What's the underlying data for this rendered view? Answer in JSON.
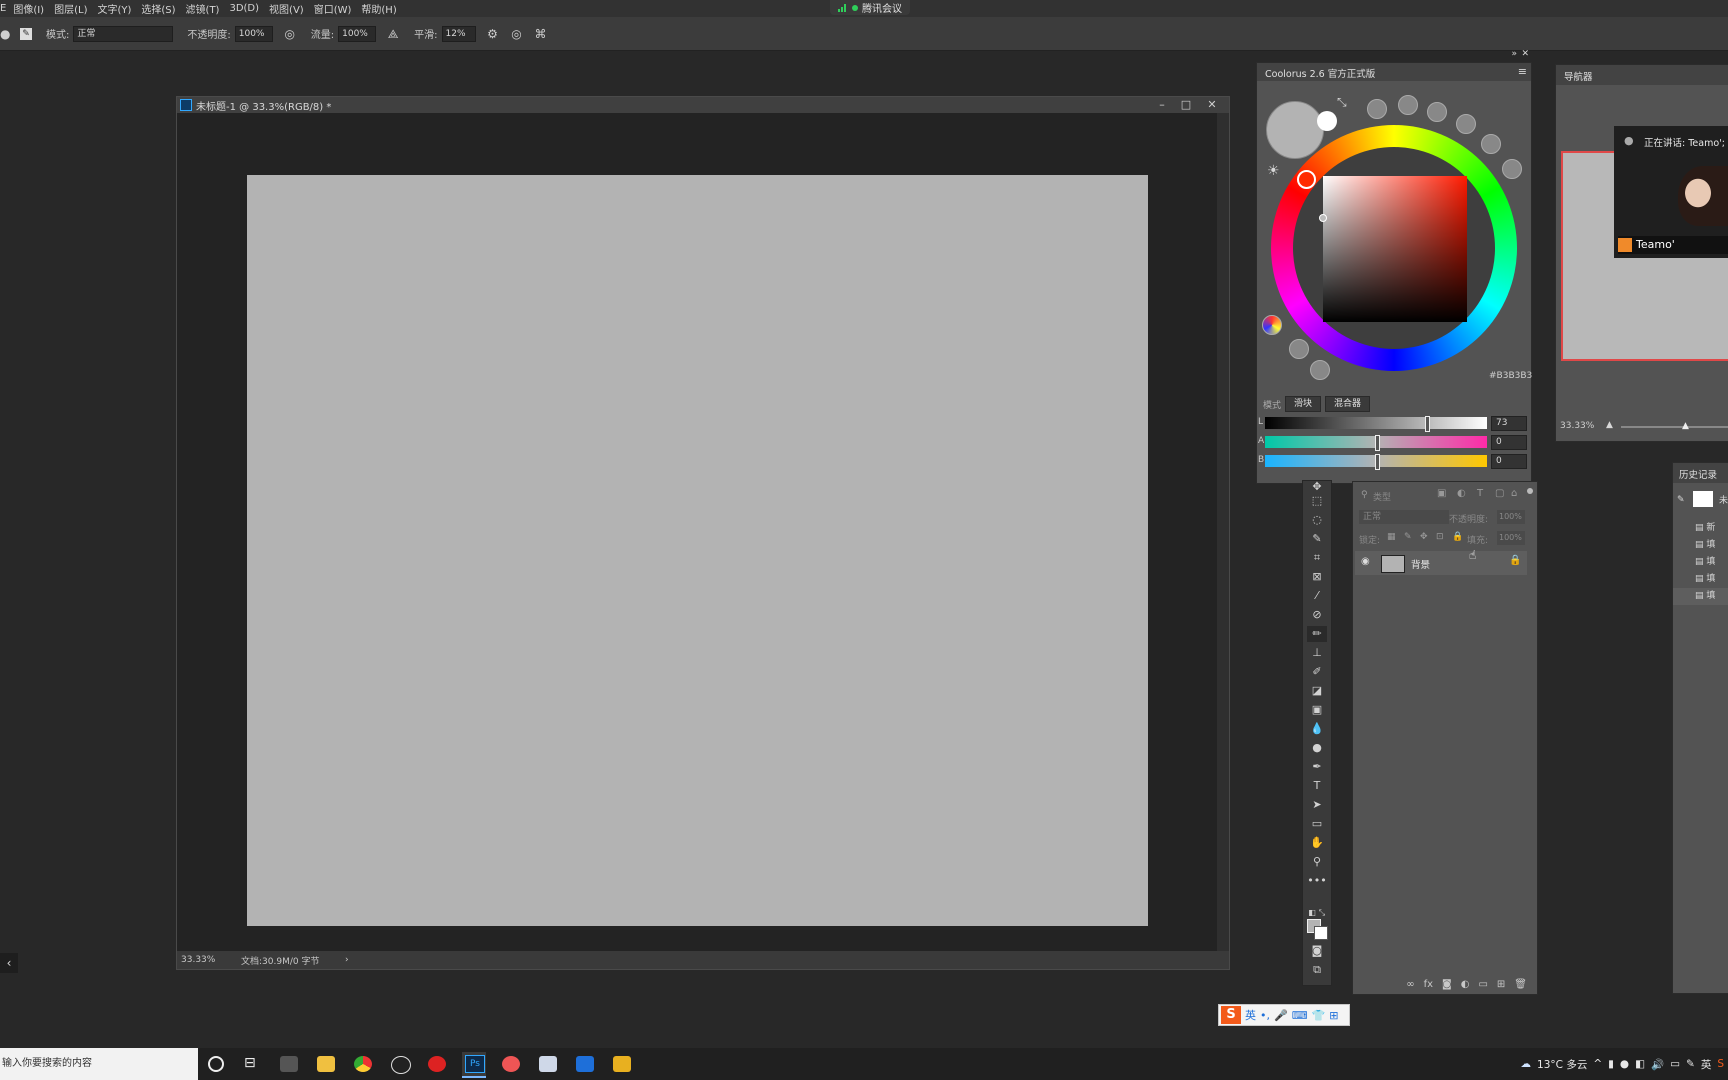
{
  "menubar": {
    "items": [
      "图像(I)",
      "图层(L)",
      "文字(Y)",
      "选择(S)",
      "滤镜(T)",
      "3D(D)",
      "视图(V)",
      "窗口(W)",
      "帮助(H)"
    ],
    "meeting_label": "腾讯会议"
  },
  "optionsbar": {
    "mode_label": "模式:",
    "mode_value": "正常",
    "opacity_label": "不透明度:",
    "opacity_value": "100%",
    "flow_label": "流量:",
    "flow_value": "100%",
    "smooth_label": "平滑:",
    "smooth_value": "12%"
  },
  "document": {
    "title": "未标题-1 @ 33.3%(RGB/8) *",
    "status_zoom": "33.33%",
    "status_info": "文档:30.9M/0 字节",
    "canvas_color": "#b3b3b3"
  },
  "coolorus": {
    "title": "Coolorus 2.6 官方正式版",
    "hex": "#B3B3B3",
    "mode_label": "模式",
    "tab_slider": "滑块",
    "tab_mixer": "混合器",
    "sliders": [
      {
        "label": "L",
        "value": "73"
      },
      {
        "label": "A",
        "value": "0"
      },
      {
        "label": "B",
        "value": "0"
      }
    ]
  },
  "navigator": {
    "tab": "导航器",
    "zoom": "33.33%"
  },
  "video": {
    "speaking": "正在讲话: Teamo';",
    "name": "Teamo'"
  },
  "layers": {
    "search_placeholder": "类型",
    "blend_mode": "正常",
    "opacity_label": "不透明度:",
    "opacity_value": "100%",
    "lock_label": "锁定:",
    "fill_label": "填充:",
    "fill_value": "100%",
    "layer_name": "背景"
  },
  "history": {
    "tab": "历史记录",
    "snapshot_label": "未",
    "rows": [
      "新",
      "填",
      "填",
      "填",
      "填"
    ]
  },
  "ime": {
    "logo": "S",
    "lang": "英"
  },
  "taskbar": {
    "search_placeholder": "输入你要搜索的内容",
    "weather": "13°C 多云",
    "ime_indicator": "英"
  }
}
